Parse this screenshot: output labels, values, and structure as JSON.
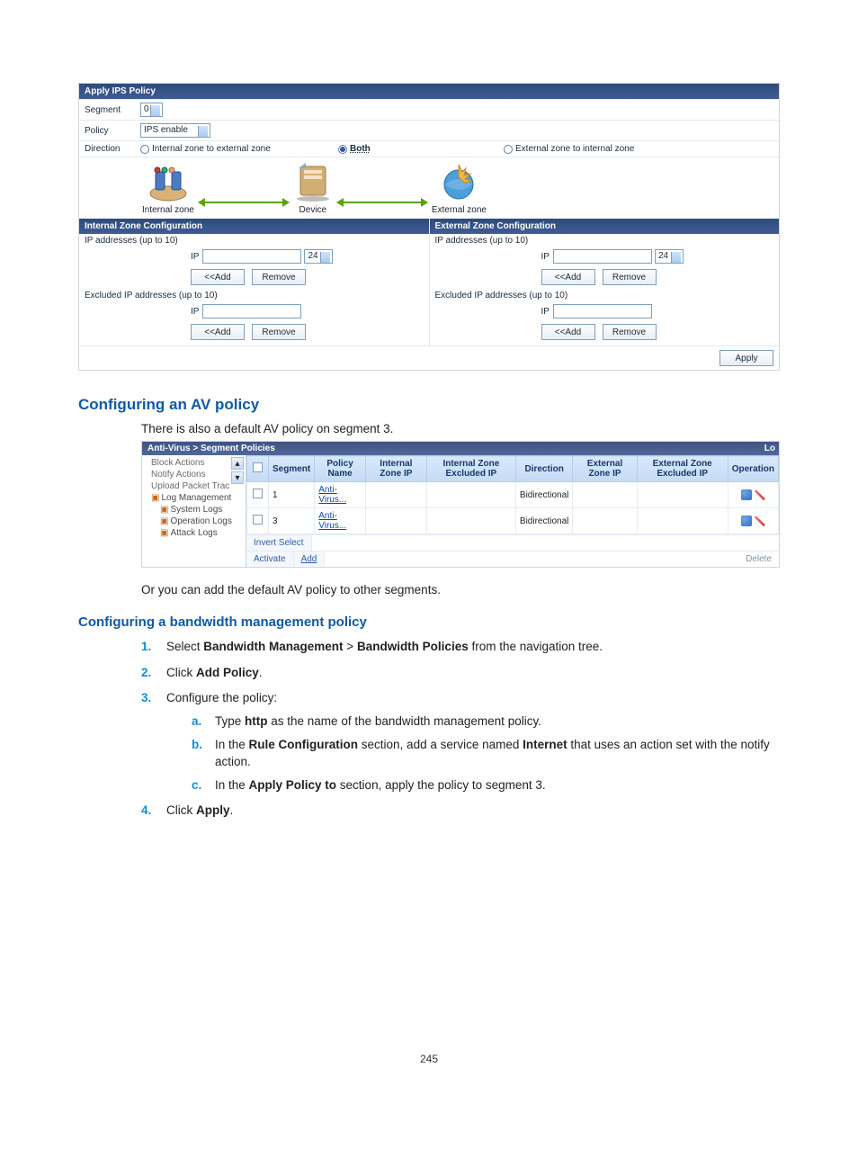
{
  "ips": {
    "header": "Apply IPS Policy",
    "segment_label": "Segment",
    "segment_value": "0",
    "policy_label": "Policy",
    "policy_value": "IPS enable",
    "direction_label": "Direction",
    "dir_a": "Internal zone to external zone",
    "dir_b": "Both",
    "dir_c": "External zone to internal zone",
    "internal_caption": "Internal zone",
    "device_caption": "Device",
    "external_caption": "External zone",
    "internal_zone_hdr": "Internal Zone Configuration",
    "external_zone_hdr": "External Zone Configuration",
    "ips_up_label": "IP addresses (up to 10)",
    "ip_label": "IP",
    "mask_value": "24",
    "add_btn": "<<Add",
    "remove_btn": "Remove",
    "excluded_label": "Excluded IP addresses (up to 10)",
    "apply_btn": "Apply"
  },
  "sections": {
    "av_title": "Configuring an AV policy",
    "av_intro": "There is also a default  AV policy on segment 3.",
    "av_outro": "Or you can add the default AV policy to other segments.",
    "bw_title": "Configuring a bandwidth management policy",
    "page_num": "245"
  },
  "av": {
    "breadcrumb": "Anti-Virus > Segment Policies",
    "corner": "Lo",
    "tree": {
      "items": [
        "Block Actions",
        "Notify Actions",
        "Upload Packet Trac"
      ],
      "log_mgmt": "Log Management",
      "system_logs": "System Logs",
      "operation_logs": "Operation Logs",
      "attack_logs": "Attack Logs"
    },
    "cols": [
      "",
      "Segment",
      "Policy Name",
      "Internal Zone IP",
      "Internal Zone Excluded IP",
      "Direction",
      "External Zone IP",
      "External Zone Excluded IP",
      "Operation"
    ],
    "rows": [
      {
        "segment": "1",
        "policy": "Anti-Virus...",
        "direction": "Bidirectional"
      },
      {
        "segment": "3",
        "policy": "Anti-Virus...",
        "direction": "Bidirectional"
      }
    ],
    "invert": "Invert Select",
    "activate": "Activate",
    "add": "Add",
    "delete": "Delete"
  },
  "steps": {
    "s1_pre": "Select ",
    "s1_b1": "Bandwidth Management",
    "s1_mid": " > ",
    "s1_b2": "Bandwidth Policies",
    "s1_post": " from the navigation tree.",
    "s2_pre": "Click ",
    "s2_b": "Add Policy",
    "s2_post": ".",
    "s3": "Configure the policy:",
    "s3a_pre": "Type ",
    "s3a_b": "http",
    "s3a_post": " as the name of the bandwidth management policy.",
    "s3b_pre": "In the ",
    "s3b_b1": "Rule Configuration",
    "s3b_mid": " section, add a service named ",
    "s3b_b2": "Internet",
    "s3b_post": " that uses an action set with the notify action.",
    "s3c_pre": "In the ",
    "s3c_b": "Apply Policy to",
    "s3c_post": " section, apply the policy to segment 3.",
    "s4_pre": "Click ",
    "s4_b": "Apply",
    "s4_post": "."
  }
}
